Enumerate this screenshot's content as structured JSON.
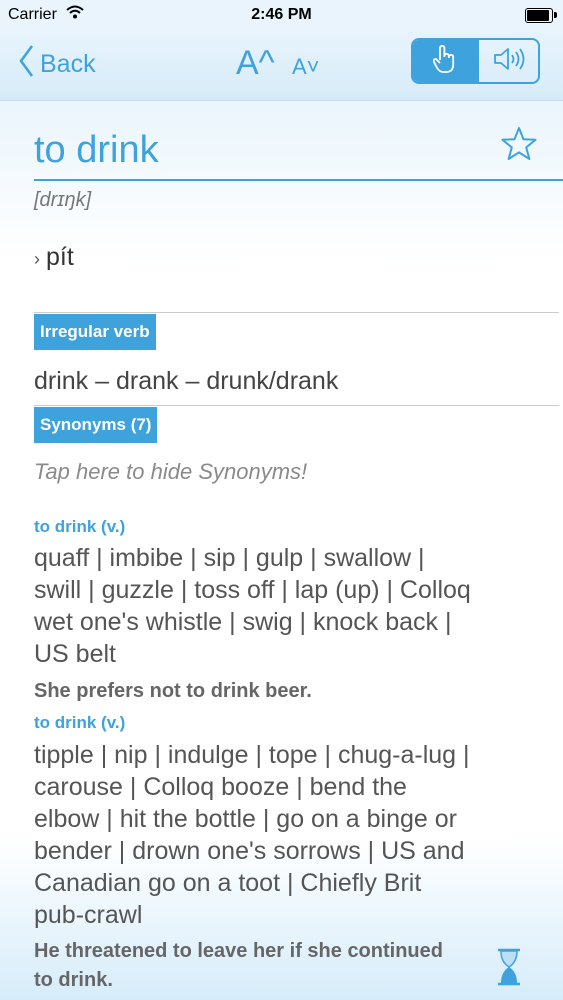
{
  "status_bar": {
    "carrier": "Carrier",
    "time": "2:46 PM",
    "battery_level": 1.0
  },
  "nav": {
    "back_label": "Back",
    "font_larger_label": "A^",
    "font_smaller_label": "A˅",
    "mode_buttons": [
      "touch-icon",
      "speaker-icon"
    ],
    "accent_color": "#3ea2dd"
  },
  "entry": {
    "headword": "to drink",
    "ipa": "[drɪŋk]",
    "translation_marker": "›",
    "translation": "pít",
    "irregular_label": "Irregular verb",
    "forms": "drink – drank – drunk/drank",
    "synonyms_label": "Synonyms (7)",
    "hide_hint": "Tap here to hide Synonyms!",
    "senses": [
      {
        "label": "to drink (v.)",
        "synonyms_lines": [
          "quaff | imbibe | sip | gulp | swallow |",
          "swill | guzzle | toss off | lap (up) | Colloq",
          "wet one's whistle | swig | knock back |",
          "US belt"
        ],
        "example": "She prefers not to drink beer."
      },
      {
        "label": "to drink (v.)",
        "synonyms_lines": [
          "tipple | nip | indulge | tope | chug-a-lug |",
          "carouse | Colloq booze | bend the",
          "elbow | hit the bottle | go on a binge or",
          "bender | drown one's sorrows | US and",
          "Canadian go on a toot | Chiefly Brit",
          "pub-crawl"
        ],
        "example_lines": [
          "He threatened to leave her if she continued",
          "to drink."
        ]
      }
    ]
  }
}
